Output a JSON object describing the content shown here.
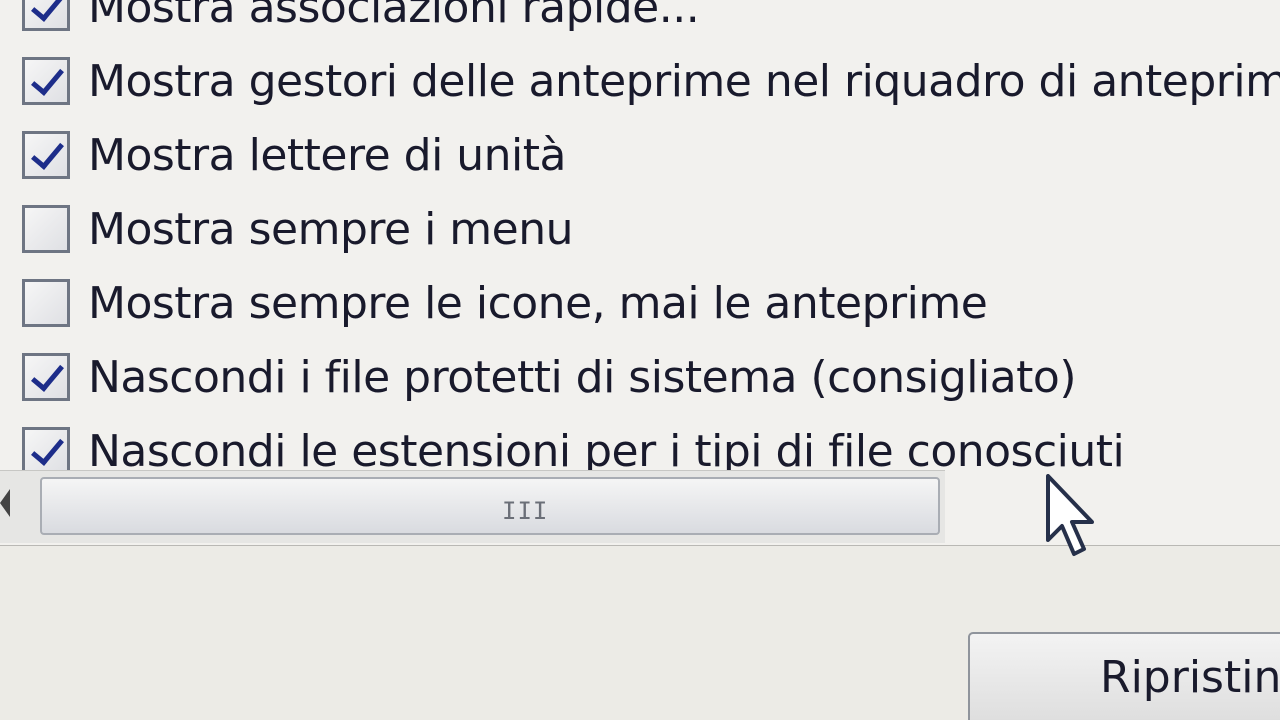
{
  "options": [
    {
      "label": "Mostra associazioni rapide...",
      "checked": true
    },
    {
      "label": "Mostra gestori delle anteprime nel riquadro di anteprima",
      "checked": true
    },
    {
      "label": "Mostra lettere di unità",
      "checked": true
    },
    {
      "label": "Mostra sempre i menu",
      "checked": false
    },
    {
      "label": "Mostra sempre le icone, mai le anteprime",
      "checked": false
    },
    {
      "label": "Nascondi i file protetti di sistema (consigliato)",
      "checked": true
    },
    {
      "label": "Nascondi le estensioni per i tipi di file conosciuti",
      "checked": true
    }
  ],
  "scrollbar": {
    "grip": "III"
  },
  "buttons": {
    "restore_label": "Ripristina"
  },
  "colors": {
    "background": "#ecebe6",
    "check": "#1d2d8a",
    "text": "#191a2c"
  }
}
